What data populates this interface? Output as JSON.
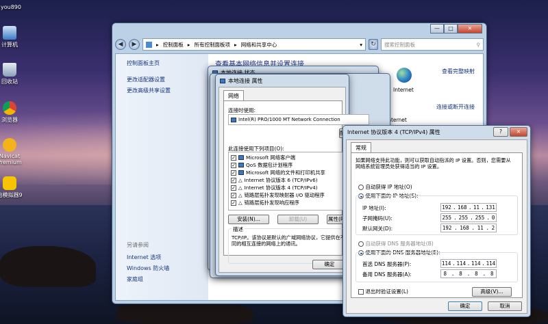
{
  "desktop": {
    "top_label": "you890",
    "icons": [
      {
        "label": "计算机",
        "icon": "computer-icon"
      },
      {
        "label": "回收站",
        "icon": "recycle-bin-icon"
      },
      {
        "label": "浏览器",
        "icon": "browser-icon"
      },
      {
        "label": "Navicat Premium",
        "icon": "navicat-icon"
      },
      {
        "label": "电模拟器9",
        "icon": "emulator-icon"
      }
    ]
  },
  "explorer": {
    "breadcrumb": [
      "控制面板",
      "所有控制面板项",
      "网络和共享中心"
    ],
    "search_placeholder": "搜索控制面板",
    "left_links": [
      "控制面板主页",
      "更改适配器设置",
      "更改高级共享设置"
    ],
    "see_also_title": "另请参阅",
    "see_also": [
      "Internet 选项",
      "Windows 防火墙",
      "家庭组"
    ],
    "main_heading": "查看基本网络信息并设置连接",
    "view_full_map": "查看完整映射",
    "internet_label": "Internet",
    "connect_disconnect": "连接或断开连接",
    "internet_label2": "Internet"
  },
  "status_dialog": {
    "title": "本地连接 状态"
  },
  "props_dialog": {
    "title": "本地连接 属性",
    "tab": "网络",
    "connect_using_label": "连接时使用:",
    "adapter": "Intel(R) PRO/1000 MT Network Connection",
    "configure_button": "配置(C)...",
    "items_label": "此连接使用下列项目(O):",
    "items": [
      "Microsoft 网络客户端",
      "QoS 数据包计划程序",
      "Microsoft 网络的文件和打印机共享",
      "Internet 协议版本 6 (TCP/IPv6)",
      "Internet 协议版本 4 (TCP/IPv4)",
      "链路层拓扑发现映射器 I/O 驱动程序",
      "链路层拓扑发现响应程序"
    ],
    "install_button": "安装(N)...",
    "uninstall_button": "卸载(U)",
    "properties_button": "属性(R)",
    "description_title": "描述",
    "description": "TCP/IP。该协议是默认的广域网络协议，它提供在不同的相互连接的网络上的通讯。",
    "ok_button": "确定"
  },
  "ipv4_dialog": {
    "title": "Internet 协议版本 4 (TCP/IPv4) 属性",
    "tab": "常规",
    "intro": "如果网络支持此功能，则可以获取自动指派的 IP 设置。否则，您需要从网络系统管理员处获得适当的 IP 设置。",
    "auto_ip": "自动获得 IP 地址(O)",
    "manual_ip": "使用下面的 IP 地址(S):",
    "ip_label": "IP 地址(I):",
    "ip": [
      "192",
      "168",
      "11",
      "131"
    ],
    "mask_label": "子网掩码(U):",
    "mask": [
      "255",
      "255",
      "255",
      "0"
    ],
    "gateway_label": "默认网关(D):",
    "gateway": [
      "192",
      "168",
      "11",
      "2"
    ],
    "auto_dns": "自动获得 DNS 服务器地址(B)",
    "manual_dns": "使用下面的 DNS 服务器地址(E):",
    "dns1_label": "首选 DNS 服务器(P):",
    "dns1": [
      "114",
      "114",
      "114",
      "114"
    ],
    "dns2_label": "备用 DNS 服务器(A):",
    "dns2": [
      "8",
      "8",
      "8",
      "8"
    ],
    "validate_label": "退出时验证设置(L)",
    "advanced_button": "高级(V)...",
    "ok_button": "确定",
    "cancel_button": "取消"
  }
}
